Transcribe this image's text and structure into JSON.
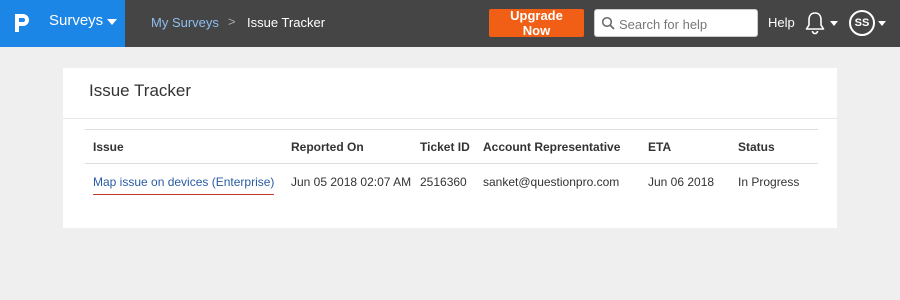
{
  "topbar": {
    "brand_label": "Surveys",
    "breadcrumb": {
      "link": "My Surveys",
      "separator": ">",
      "current": "Issue Tracker"
    },
    "upgrade_label": "Upgrade Now",
    "search_placeholder": "Search for help",
    "help_label": "Help",
    "avatar_initials": "SS"
  },
  "card": {
    "title": "Issue Tracker",
    "columns": [
      "Issue",
      "Reported On",
      "Ticket ID",
      "Account Representative",
      "ETA",
      "Status"
    ],
    "rows": [
      {
        "issue": "Map issue on devices (Enterprise)",
        "reported_on": "Jun 05 2018 02:07 AM",
        "ticket_id": "2516360",
        "account_rep": "sanket@questionpro.com",
        "eta": "Jun 06 2018",
        "status": "In Progress"
      }
    ]
  },
  "colors": {
    "brand": "#1c86e6",
    "topbar": "#454545",
    "upgrade": "#f15f16",
    "link": "#2a5ba5",
    "link_underline": "#c0392b"
  }
}
